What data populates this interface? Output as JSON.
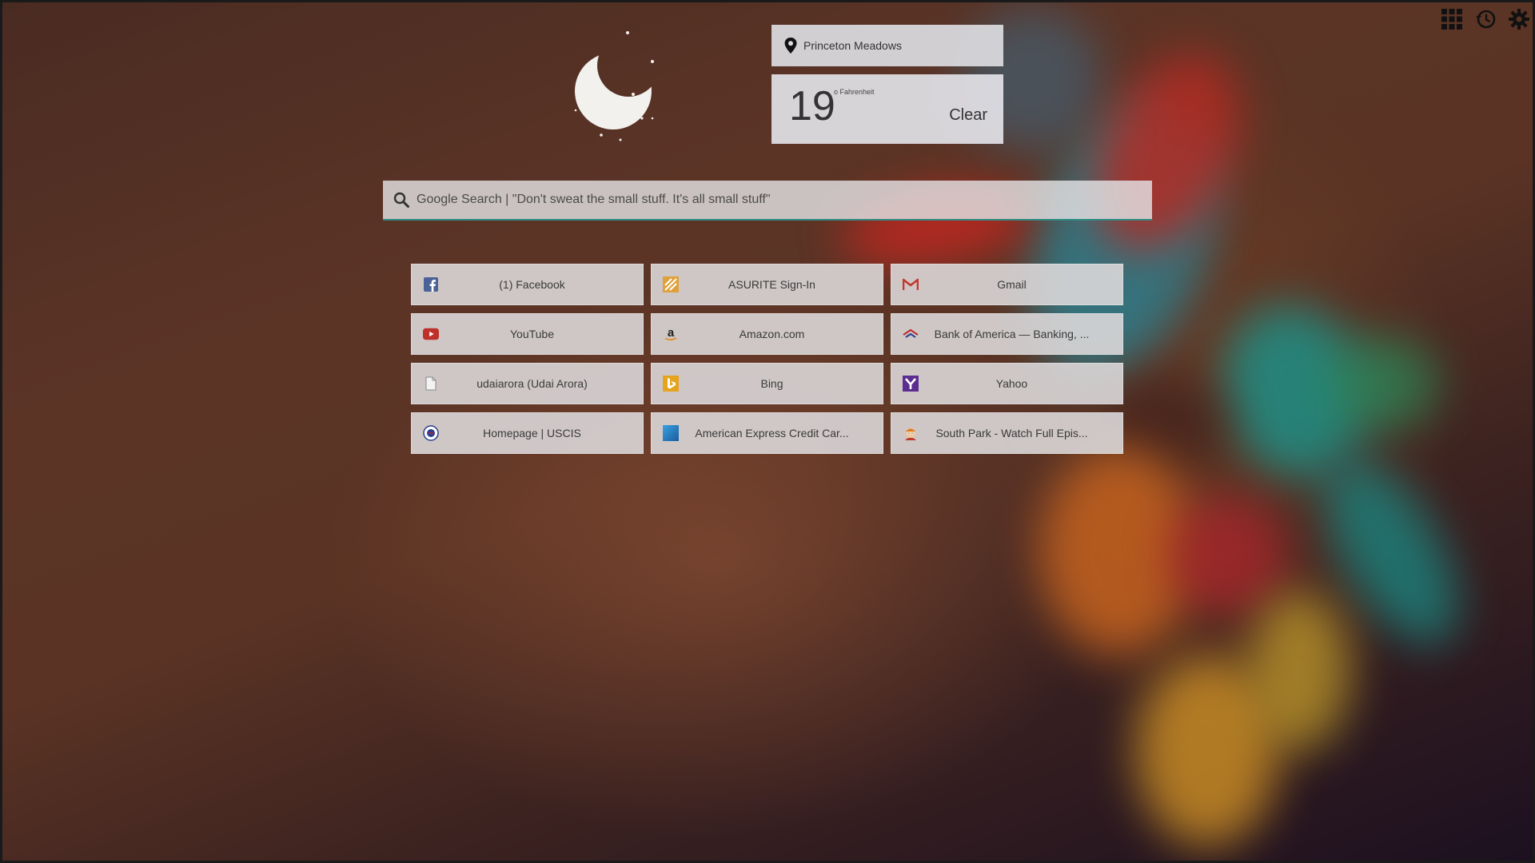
{
  "location": {
    "name": "Princeton Meadows"
  },
  "weather": {
    "temperature": "19",
    "unit": "o Fahrenheit",
    "condition": "Clear"
  },
  "search": {
    "placeholder": "Google Search | \"Don't sweat the small stuff. It's all small stuff\""
  },
  "top_icons": [
    "apps-grid-icon",
    "history-icon",
    "settings-gear-icon"
  ],
  "tiles": [
    {
      "label": "(1) Facebook",
      "icon": "facebook-icon"
    },
    {
      "label": "ASURITE Sign-In",
      "icon": "asu-icon"
    },
    {
      "label": "Gmail",
      "icon": "gmail-icon"
    },
    {
      "label": "YouTube",
      "icon": "youtube-icon"
    },
    {
      "label": "Amazon.com",
      "icon": "amazon-icon"
    },
    {
      "label": "Bank of America — Banking, ...",
      "icon": "bank-of-america-icon"
    },
    {
      "label": "udaiarora (Udai Arora)",
      "icon": "document-icon"
    },
    {
      "label": "Bing",
      "icon": "bing-icon"
    },
    {
      "label": "Yahoo",
      "icon": "yahoo-icon"
    },
    {
      "label": "Homepage | USCIS",
      "icon": "uscis-icon"
    },
    {
      "label": "American Express Credit Car...",
      "icon": "amex-icon"
    },
    {
      "label": "South Park - Watch Full Epis...",
      "icon": "south-park-icon"
    }
  ],
  "colors": {
    "search_underline": "#2f8c83",
    "panel_bg": "#dcdce1"
  }
}
